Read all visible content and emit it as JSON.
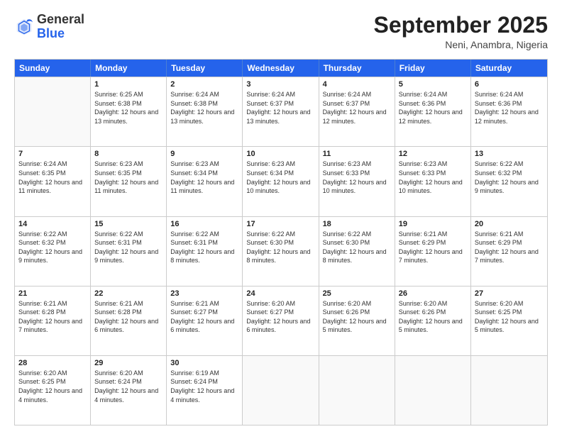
{
  "header": {
    "logo": {
      "general": "General",
      "blue": "Blue"
    },
    "title": "September 2025",
    "location": "Neni, Anambra, Nigeria"
  },
  "days_of_week": [
    "Sunday",
    "Monday",
    "Tuesday",
    "Wednesday",
    "Thursday",
    "Friday",
    "Saturday"
  ],
  "weeks": [
    [
      {
        "day": "",
        "empty": true
      },
      {
        "day": "1",
        "sunrise": "Sunrise: 6:25 AM",
        "sunset": "Sunset: 6:38 PM",
        "daylight": "Daylight: 12 hours and 13 minutes."
      },
      {
        "day": "2",
        "sunrise": "Sunrise: 6:24 AM",
        "sunset": "Sunset: 6:38 PM",
        "daylight": "Daylight: 12 hours and 13 minutes."
      },
      {
        "day": "3",
        "sunrise": "Sunrise: 6:24 AM",
        "sunset": "Sunset: 6:37 PM",
        "daylight": "Daylight: 12 hours and 13 minutes."
      },
      {
        "day": "4",
        "sunrise": "Sunrise: 6:24 AM",
        "sunset": "Sunset: 6:37 PM",
        "daylight": "Daylight: 12 hours and 12 minutes."
      },
      {
        "day": "5",
        "sunrise": "Sunrise: 6:24 AM",
        "sunset": "Sunset: 6:36 PM",
        "daylight": "Daylight: 12 hours and 12 minutes."
      },
      {
        "day": "6",
        "sunrise": "Sunrise: 6:24 AM",
        "sunset": "Sunset: 6:36 PM",
        "daylight": "Daylight: 12 hours and 12 minutes."
      }
    ],
    [
      {
        "day": "7",
        "sunrise": "Sunrise: 6:24 AM",
        "sunset": "Sunset: 6:35 PM",
        "daylight": "Daylight: 12 hours and 11 minutes."
      },
      {
        "day": "8",
        "sunrise": "Sunrise: 6:23 AM",
        "sunset": "Sunset: 6:35 PM",
        "daylight": "Daylight: 12 hours and 11 minutes."
      },
      {
        "day": "9",
        "sunrise": "Sunrise: 6:23 AM",
        "sunset": "Sunset: 6:34 PM",
        "daylight": "Daylight: 12 hours and 11 minutes."
      },
      {
        "day": "10",
        "sunrise": "Sunrise: 6:23 AM",
        "sunset": "Sunset: 6:34 PM",
        "daylight": "Daylight: 12 hours and 10 minutes."
      },
      {
        "day": "11",
        "sunrise": "Sunrise: 6:23 AM",
        "sunset": "Sunset: 6:33 PM",
        "daylight": "Daylight: 12 hours and 10 minutes."
      },
      {
        "day": "12",
        "sunrise": "Sunrise: 6:23 AM",
        "sunset": "Sunset: 6:33 PM",
        "daylight": "Daylight: 12 hours and 10 minutes."
      },
      {
        "day": "13",
        "sunrise": "Sunrise: 6:22 AM",
        "sunset": "Sunset: 6:32 PM",
        "daylight": "Daylight: 12 hours and 9 minutes."
      }
    ],
    [
      {
        "day": "14",
        "sunrise": "Sunrise: 6:22 AM",
        "sunset": "Sunset: 6:32 PM",
        "daylight": "Daylight: 12 hours and 9 minutes."
      },
      {
        "day": "15",
        "sunrise": "Sunrise: 6:22 AM",
        "sunset": "Sunset: 6:31 PM",
        "daylight": "Daylight: 12 hours and 9 minutes."
      },
      {
        "day": "16",
        "sunrise": "Sunrise: 6:22 AM",
        "sunset": "Sunset: 6:31 PM",
        "daylight": "Daylight: 12 hours and 8 minutes."
      },
      {
        "day": "17",
        "sunrise": "Sunrise: 6:22 AM",
        "sunset": "Sunset: 6:30 PM",
        "daylight": "Daylight: 12 hours and 8 minutes."
      },
      {
        "day": "18",
        "sunrise": "Sunrise: 6:22 AM",
        "sunset": "Sunset: 6:30 PM",
        "daylight": "Daylight: 12 hours and 8 minutes."
      },
      {
        "day": "19",
        "sunrise": "Sunrise: 6:21 AM",
        "sunset": "Sunset: 6:29 PM",
        "daylight": "Daylight: 12 hours and 7 minutes."
      },
      {
        "day": "20",
        "sunrise": "Sunrise: 6:21 AM",
        "sunset": "Sunset: 6:29 PM",
        "daylight": "Daylight: 12 hours and 7 minutes."
      }
    ],
    [
      {
        "day": "21",
        "sunrise": "Sunrise: 6:21 AM",
        "sunset": "Sunset: 6:28 PM",
        "daylight": "Daylight: 12 hours and 7 minutes."
      },
      {
        "day": "22",
        "sunrise": "Sunrise: 6:21 AM",
        "sunset": "Sunset: 6:28 PM",
        "daylight": "Daylight: 12 hours and 6 minutes."
      },
      {
        "day": "23",
        "sunrise": "Sunrise: 6:21 AM",
        "sunset": "Sunset: 6:27 PM",
        "daylight": "Daylight: 12 hours and 6 minutes."
      },
      {
        "day": "24",
        "sunrise": "Sunrise: 6:20 AM",
        "sunset": "Sunset: 6:27 PM",
        "daylight": "Daylight: 12 hours and 6 minutes."
      },
      {
        "day": "25",
        "sunrise": "Sunrise: 6:20 AM",
        "sunset": "Sunset: 6:26 PM",
        "daylight": "Daylight: 12 hours and 5 minutes."
      },
      {
        "day": "26",
        "sunrise": "Sunrise: 6:20 AM",
        "sunset": "Sunset: 6:26 PM",
        "daylight": "Daylight: 12 hours and 5 minutes."
      },
      {
        "day": "27",
        "sunrise": "Sunrise: 6:20 AM",
        "sunset": "Sunset: 6:25 PM",
        "daylight": "Daylight: 12 hours and 5 minutes."
      }
    ],
    [
      {
        "day": "28",
        "sunrise": "Sunrise: 6:20 AM",
        "sunset": "Sunset: 6:25 PM",
        "daylight": "Daylight: 12 hours and 4 minutes."
      },
      {
        "day": "29",
        "sunrise": "Sunrise: 6:20 AM",
        "sunset": "Sunset: 6:24 PM",
        "daylight": "Daylight: 12 hours and 4 minutes."
      },
      {
        "day": "30",
        "sunrise": "Sunrise: 6:19 AM",
        "sunset": "Sunset: 6:24 PM",
        "daylight": "Daylight: 12 hours and 4 minutes."
      },
      {
        "day": "",
        "empty": true
      },
      {
        "day": "",
        "empty": true
      },
      {
        "day": "",
        "empty": true
      },
      {
        "day": "",
        "empty": true
      }
    ]
  ]
}
